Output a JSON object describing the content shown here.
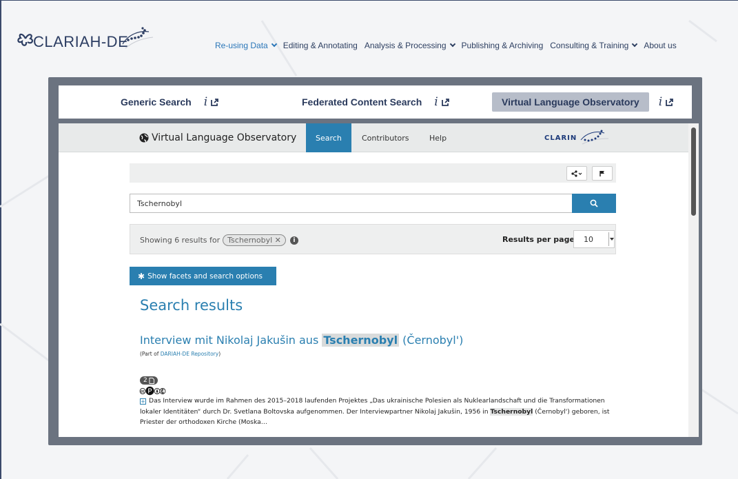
{
  "header": {
    "logo_text": "CLARIAH-DE",
    "nav": [
      {
        "label": "Re-using Data",
        "dropdown": true,
        "active": true
      },
      {
        "label": "Editing & Annotating",
        "dropdown": false,
        "active": false
      },
      {
        "label": "Analysis & Processing",
        "dropdown": true,
        "active": false
      },
      {
        "label": "Publishing & Archiving",
        "dropdown": false,
        "active": false
      },
      {
        "label": "Consulting & Training",
        "dropdown": true,
        "active": false
      },
      {
        "label": "About us",
        "dropdown": false,
        "active": false
      }
    ]
  },
  "search_tabs": {
    "generic": "Generic Search",
    "federated": "Federated Content Search",
    "vlo": "Virtual Language Observatory",
    "info_symbol": "i"
  },
  "vlo": {
    "brand": "Virtual Language Observatory",
    "tabs": {
      "search": "Search",
      "contributors": "Contributors",
      "help": "Help"
    },
    "clarin_text": "CLARIN",
    "search_query": "Tschernobyl",
    "results": {
      "prefix": "Showing 6 results for",
      "chip": "Tschernobyl",
      "chip_close": "✕",
      "info": "i",
      "per_page_label": "Results per page:",
      "per_page_value": "10"
    },
    "facets_button": "Show facets and search options",
    "heading": "Search results",
    "result": {
      "title_pre": "Interview mit Nikolaj Jakušin aus",
      "title_hl": "Tschernobyl",
      "title_post": "(Černobyl')",
      "part_of_pre": "(Part of",
      "part_of_link": "DARIAH-DE Repository",
      "part_of_post": ")",
      "count": "2",
      "cc_icons": "🅭🅟🅯🅮",
      "desc_1": "Das Interview wurde im Rahmen des 2015–2018 laufenden Projektes „Das ukrainische Polesien als Nuklearlandschaft und die Transformationen lokaler Identitäten“ durch Dr. Svetlana Boltovska aufgenommen. Der Interviewpartner Nikolaj Jakušin, 1956 in",
      "desc_hl": "Tschernobyl",
      "desc_2": "(Černobyl') geboren, ist Priester der orthodoxen Kirche (Moska…"
    }
  },
  "colors": {
    "accent": "#2a7fb0",
    "brand": "#2d3e63",
    "frame": "#6b7380"
  }
}
